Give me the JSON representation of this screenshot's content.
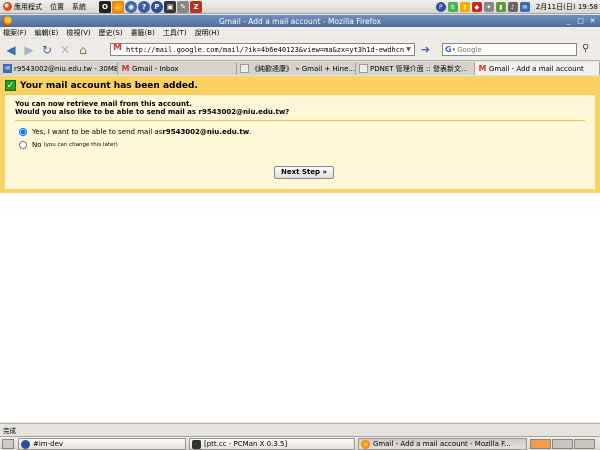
{
  "top_panel": {
    "menu_items": [
      "應用程式",
      "位置",
      "系統"
    ],
    "clock": "2月11日(日) 19:58"
  },
  "window": {
    "title": "Gmail - Add a mail account - Mozilla Firefox"
  },
  "menu_bar": [
    "檔案(F)",
    "編輯(E)",
    "檢視(V)",
    "歷史(S)",
    "書籤(B)",
    "工具(T)",
    "說明(H)"
  ],
  "nav": {
    "url": "http://mail.google.com/mail/?ik=4b6e40123&view=ma&zx=yt3h1d-ewdhcn",
    "search_placeholder": "Google"
  },
  "tabs": [
    {
      "label": "r9543002@niu.edu.tw - 30MB",
      "active": false
    },
    {
      "label": "Gmail - Inbox",
      "active": false
    },
    {
      "label": "《純歡達康》 » Gmail + Hine...",
      "active": false
    },
    {
      "label": "PDNET 管理介面 :: 發表新文...",
      "active": false
    },
    {
      "label": "Gmail - Add a mail account",
      "active": true
    }
  ],
  "content": {
    "banner_title": "Your mail account has been added.",
    "question_line1": "You can now retrieve mail from this account.",
    "question_line2": "Would you also like to be able to send mail as r9543002@niu.edu.tw?",
    "option_yes_prefix": "Yes, I want to be able to send mail as ",
    "option_yes_email": "r9543002@niu.edu.tw",
    "option_yes_suffix": ".",
    "option_no": "No",
    "option_no_note": "(you can change this later)",
    "next_button": "Next Step »"
  },
  "status_bar": "完成",
  "taskbar": [
    {
      "label": "#im-dev",
      "active": false
    },
    {
      "label": "[ptt.cc - PCMan X 0.3.5]",
      "active": false
    },
    {
      "label": "Gmail - Add a mail account - Mozilla F...",
      "active": true
    }
  ],
  "colors": {
    "banner": "#fad163",
    "inner": "#fff7d7",
    "separator": "#f0c64d",
    "check": "#2d9a2a"
  }
}
